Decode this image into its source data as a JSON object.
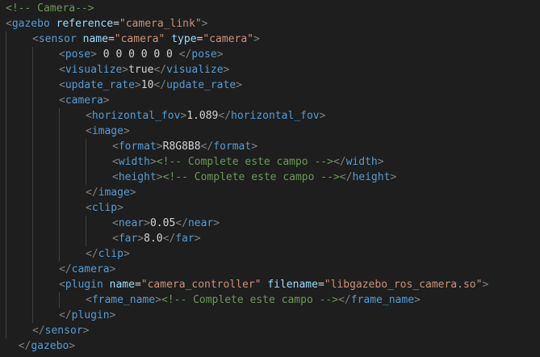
{
  "editor": {
    "language": "xml",
    "colors": {
      "background": "#1e1e1e",
      "indent_guide": "#404040",
      "punctuation": "#808080",
      "tag": "#569cd6",
      "attribute": "#9cdcfe",
      "string": "#ce9178",
      "text": "#d4d4d4",
      "comment": "#6a9955"
    },
    "lines": [
      {
        "indent": 0,
        "tokens": [
          [
            "comment",
            "<!-- Camera-->"
          ]
        ]
      },
      {
        "indent": 0,
        "tokens": [
          [
            "punc",
            "<"
          ],
          [
            "tag",
            "gazebo"
          ],
          [
            "text",
            " "
          ],
          [
            "attr",
            "reference"
          ],
          [
            "eq",
            "="
          ],
          [
            "str",
            "\"camera_link\""
          ],
          [
            "punc",
            ">"
          ]
        ]
      },
      {
        "indent": 1,
        "tokens": [
          [
            "punc",
            "<"
          ],
          [
            "tag",
            "sensor"
          ],
          [
            "text",
            " "
          ],
          [
            "attr",
            "name"
          ],
          [
            "eq",
            "="
          ],
          [
            "str",
            "\"camera\""
          ],
          [
            "text",
            " "
          ],
          [
            "attr",
            "type"
          ],
          [
            "eq",
            "="
          ],
          [
            "str",
            "\"camera\""
          ],
          [
            "punc",
            ">"
          ]
        ]
      },
      {
        "indent": 2,
        "tokens": [
          [
            "punc",
            "<"
          ],
          [
            "tag",
            "pose"
          ],
          [
            "punc",
            ">"
          ],
          [
            "text",
            " 0 0 0 0 0 0 "
          ],
          [
            "punc",
            "</"
          ],
          [
            "tag",
            "pose"
          ],
          [
            "punc",
            ">"
          ]
        ]
      },
      {
        "indent": 2,
        "tokens": [
          [
            "punc",
            "<"
          ],
          [
            "tag",
            "visualize"
          ],
          [
            "punc",
            ">"
          ],
          [
            "text",
            "true"
          ],
          [
            "punc",
            "</"
          ],
          [
            "tag",
            "visualize"
          ],
          [
            "punc",
            ">"
          ]
        ]
      },
      {
        "indent": 2,
        "tokens": [
          [
            "punc",
            "<"
          ],
          [
            "tag",
            "update_rate"
          ],
          [
            "punc",
            ">"
          ],
          [
            "text",
            "10"
          ],
          [
            "punc",
            "</"
          ],
          [
            "tag",
            "update_rate"
          ],
          [
            "punc",
            ">"
          ]
        ]
      },
      {
        "indent": 2,
        "tokens": [
          [
            "punc",
            "<"
          ],
          [
            "tag",
            "camera"
          ],
          [
            "punc",
            ">"
          ]
        ]
      },
      {
        "indent": 3,
        "tokens": [
          [
            "punc",
            "<"
          ],
          [
            "tag",
            "horizontal_fov"
          ],
          [
            "punc",
            ">"
          ],
          [
            "text",
            "1.089"
          ],
          [
            "punc",
            "</"
          ],
          [
            "tag",
            "horizontal_fov"
          ],
          [
            "punc",
            ">"
          ]
        ]
      },
      {
        "indent": 3,
        "tokens": [
          [
            "punc",
            "<"
          ],
          [
            "tag",
            "image"
          ],
          [
            "punc",
            ">"
          ]
        ]
      },
      {
        "indent": 4,
        "tokens": [
          [
            "punc",
            "<"
          ],
          [
            "tag",
            "format"
          ],
          [
            "punc",
            ">"
          ],
          [
            "text",
            "R8G8B8"
          ],
          [
            "punc",
            "</"
          ],
          [
            "tag",
            "format"
          ],
          [
            "punc",
            ">"
          ]
        ]
      },
      {
        "indent": 4,
        "tokens": [
          [
            "punc",
            "<"
          ],
          [
            "tag",
            "width"
          ],
          [
            "punc",
            ">"
          ],
          [
            "comment",
            "<!-- Complete este campo -->"
          ],
          [
            "punc",
            "</"
          ],
          [
            "tag",
            "width"
          ],
          [
            "punc",
            ">"
          ]
        ]
      },
      {
        "indent": 4,
        "tokens": [
          [
            "punc",
            "<"
          ],
          [
            "tag",
            "height"
          ],
          [
            "punc",
            ">"
          ],
          [
            "comment",
            "<!-- Complete este campo -->"
          ],
          [
            "punc",
            "</"
          ],
          [
            "tag",
            "height"
          ],
          [
            "punc",
            ">"
          ]
        ]
      },
      {
        "indent": 3,
        "tokens": [
          [
            "punc",
            "</"
          ],
          [
            "tag",
            "image"
          ],
          [
            "punc",
            ">"
          ]
        ]
      },
      {
        "indent": 3,
        "tokens": [
          [
            "punc",
            "<"
          ],
          [
            "tag",
            "clip"
          ],
          [
            "punc",
            ">"
          ]
        ]
      },
      {
        "indent": 4,
        "tokens": [
          [
            "punc",
            "<"
          ],
          [
            "tag",
            "near"
          ],
          [
            "punc",
            ">"
          ],
          [
            "text",
            "0.05"
          ],
          [
            "punc",
            "</"
          ],
          [
            "tag",
            "near"
          ],
          [
            "punc",
            ">"
          ]
        ]
      },
      {
        "indent": 4,
        "tokens": [
          [
            "punc",
            "<"
          ],
          [
            "tag",
            "far"
          ],
          [
            "punc",
            ">"
          ],
          [
            "text",
            "8.0"
          ],
          [
            "punc",
            "</"
          ],
          [
            "tag",
            "far"
          ],
          [
            "punc",
            ">"
          ]
        ]
      },
      {
        "indent": 3,
        "tokens": [
          [
            "punc",
            "</"
          ],
          [
            "tag",
            "clip"
          ],
          [
            "punc",
            ">"
          ]
        ]
      },
      {
        "indent": 2,
        "tokens": [
          [
            "punc",
            "</"
          ],
          [
            "tag",
            "camera"
          ],
          [
            "punc",
            ">"
          ]
        ]
      },
      {
        "indent": 2,
        "tokens": [
          [
            "punc",
            "<"
          ],
          [
            "tag",
            "plugin"
          ],
          [
            "text",
            " "
          ],
          [
            "attr",
            "name"
          ],
          [
            "eq",
            "="
          ],
          [
            "str",
            "\"camera_controller\""
          ],
          [
            "text",
            " "
          ],
          [
            "attr",
            "filename"
          ],
          [
            "eq",
            "="
          ],
          [
            "str",
            "\"libgazebo_ros_camera.so\""
          ],
          [
            "punc",
            ">"
          ]
        ]
      },
      {
        "indent": 3,
        "tokens": [
          [
            "punc",
            "<"
          ],
          [
            "tag",
            "frame_name"
          ],
          [
            "punc",
            ">"
          ],
          [
            "comment",
            "<!-- Complete este campo -->"
          ],
          [
            "punc",
            "</"
          ],
          [
            "tag",
            "frame_name"
          ],
          [
            "punc",
            ">"
          ]
        ]
      },
      {
        "indent": 2,
        "tokens": [
          [
            "punc",
            "</"
          ],
          [
            "tag",
            "plugin"
          ],
          [
            "punc",
            ">"
          ]
        ]
      },
      {
        "indent": 1,
        "tokens": [
          [
            "punc",
            "</"
          ],
          [
            "tag",
            "sensor"
          ],
          [
            "punc",
            ">"
          ]
        ]
      },
      {
        "indent": 0,
        "tokens": [
          [
            "punc",
            "  </"
          ],
          [
            "tag",
            "gazebo"
          ],
          [
            "punc",
            ">"
          ]
        ]
      }
    ]
  }
}
